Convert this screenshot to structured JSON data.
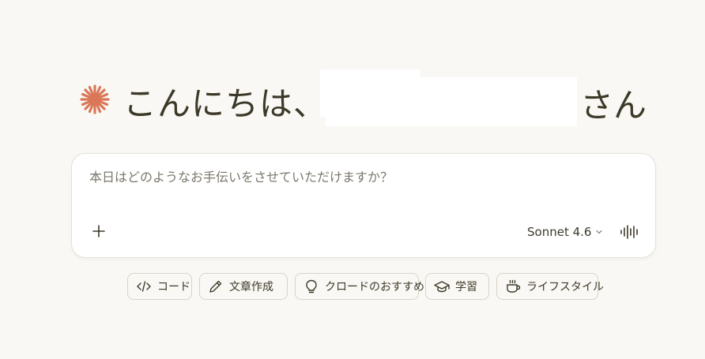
{
  "greeting": {
    "prefix": "こんにちは、",
    "suffix": "さん"
  },
  "composer": {
    "placeholder": "本日はどのようなお手伝いをさせていただけますか？",
    "model_label": "Sonnet 4.6"
  },
  "chips": [
    {
      "label": "コード",
      "icon": "code-icon"
    },
    {
      "label": "文章作成",
      "icon": "pencil-icon"
    },
    {
      "label": "クロードのおすすめ",
      "icon": "lightbulb-icon"
    },
    {
      "label": "学習",
      "icon": "graduation-cap-icon"
    },
    {
      "label": "ライフスタイル",
      "icon": "coffee-cup-icon"
    }
  ],
  "colors": {
    "background": "#faf8f4",
    "accent": "#d97757",
    "text": "#3d3929"
  }
}
